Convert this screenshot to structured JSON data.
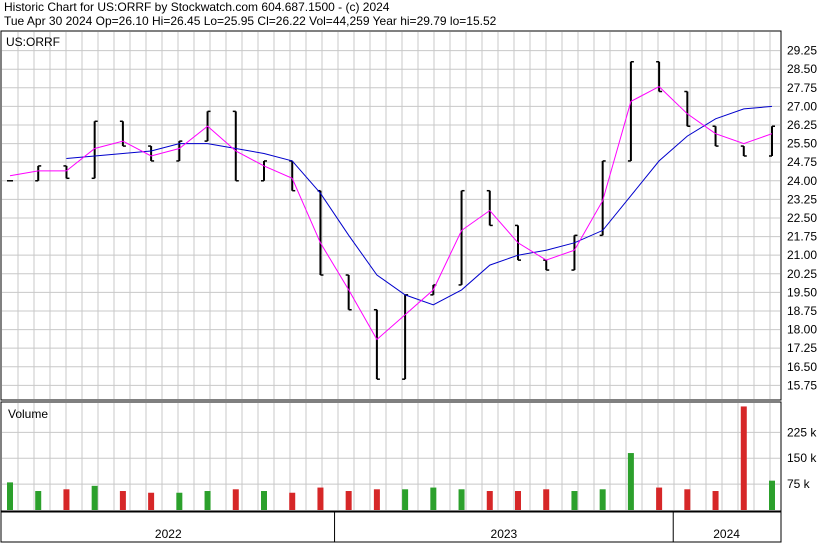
{
  "header": {
    "title": "Historic Chart for US:ORRF by Stockwatch.com 604.687.1500 - (c) 2024",
    "summary": "Tue Apr 30 2024  Op=26.10  Hi=26.45  Lo=25.95  Cl=26.22  Vol=44,259  Year hi=29.79  lo=15.52"
  },
  "price_panel": {
    "symbol": "US:ORRF"
  },
  "volume_panel": {
    "label": "Volume"
  },
  "colors": {
    "background": "#ffffff",
    "grid": "#c8c8c8",
    "price_bars": "#000000",
    "ma_short": "#ff00ff",
    "ma_long": "#0000cc",
    "volume_up": "#2ca02c",
    "volume_down": "#d62728",
    "frame": "#000000"
  },
  "chart_data": [
    {
      "type": "ohlc",
      "symbol": "US:ORRF",
      "ylim": [
        15.2,
        30.0
      ],
      "yticks": [
        "29.25",
        "28.50",
        "27.75",
        "27.00",
        "26.25",
        "25.50",
        "24.75",
        "24.00",
        "23.25",
        "22.50",
        "21.75",
        "21.00",
        "20.25",
        "19.50",
        "18.75",
        "18.00",
        "17.25",
        "16.50",
        "15.75"
      ],
      "x": [
        "2022-01",
        "2022-02",
        "2022-03",
        "2022-04",
        "2022-05",
        "2022-06",
        "2022-07",
        "2022-08",
        "2022-09",
        "2022-10",
        "2022-11",
        "2022-12",
        "2023-01",
        "2023-02",
        "2023-03",
        "2023-04",
        "2023-05",
        "2023-06",
        "2023-07",
        "2023-08",
        "2023-09",
        "2023-10",
        "2023-11",
        "2023-12",
        "2024-01",
        "2024-02",
        "2024-03",
        "2024-04"
      ],
      "close": [
        24.0,
        24.6,
        24.1,
        26.4,
        25.4,
        24.8,
        25.6,
        26.8,
        24.0,
        24.8,
        23.6,
        20.2,
        18.8,
        16.0,
        19.4,
        19.8,
        23.6,
        22.2,
        20.8,
        20.4,
        21.8,
        24.8,
        28.8,
        27.6,
        26.2,
        25.4,
        25.0,
        26.2
      ],
      "series": [
        {
          "name": "",
          "role": "short moving average",
          "values": [
            24.2,
            24.4,
            24.4,
            25.3,
            25.6,
            25.0,
            25.3,
            26.2,
            25.2,
            24.6,
            24.1,
            21.5,
            19.6,
            17.6,
            18.6,
            19.6,
            22.0,
            22.8,
            21.5,
            20.8,
            21.2,
            23.2,
            27.2,
            27.8,
            26.7,
            25.9,
            25.5,
            25.9
          ]
        },
        {
          "name": "",
          "role": "long moving average",
          "values": [
            null,
            null,
            24.9,
            25.0,
            25.1,
            25.2,
            25.5,
            25.5,
            25.3,
            25.1,
            24.8,
            23.5,
            21.8,
            20.2,
            19.4,
            19.0,
            19.6,
            20.6,
            21.0,
            21.2,
            21.5,
            22.0,
            23.4,
            24.8,
            25.8,
            26.5,
            26.9,
            27.0
          ]
        }
      ],
      "xlabels": [
        "2022",
        "2023",
        "2024"
      ],
      "grid": true
    },
    {
      "type": "bar",
      "label": "Volume",
      "yticks": [
        "225 k",
        "150 k",
        "75 k"
      ],
      "ylim": [
        0,
        310000
      ],
      "x": [
        "2022-01",
        "2022-02",
        "2022-03",
        "2022-04",
        "2022-05",
        "2022-06",
        "2022-07",
        "2022-08",
        "2022-09",
        "2022-10",
        "2022-11",
        "2022-12",
        "2023-01",
        "2023-02",
        "2023-03",
        "2023-04",
        "2023-05",
        "2023-06",
        "2023-07",
        "2023-08",
        "2023-09",
        "2023-10",
        "2023-11",
        "2023-12",
        "2024-01",
        "2024-02",
        "2024-03",
        "2024-04"
      ],
      "values": [
        80000,
        55000,
        60000,
        70000,
        55000,
        50000,
        50000,
        55000,
        60000,
        55000,
        50000,
        65000,
        55000,
        60000,
        60000,
        65000,
        60000,
        55000,
        55000,
        60000,
        55000,
        60000,
        165000,
        65000,
        60000,
        55000,
        300000,
        85000
      ]
    }
  ]
}
